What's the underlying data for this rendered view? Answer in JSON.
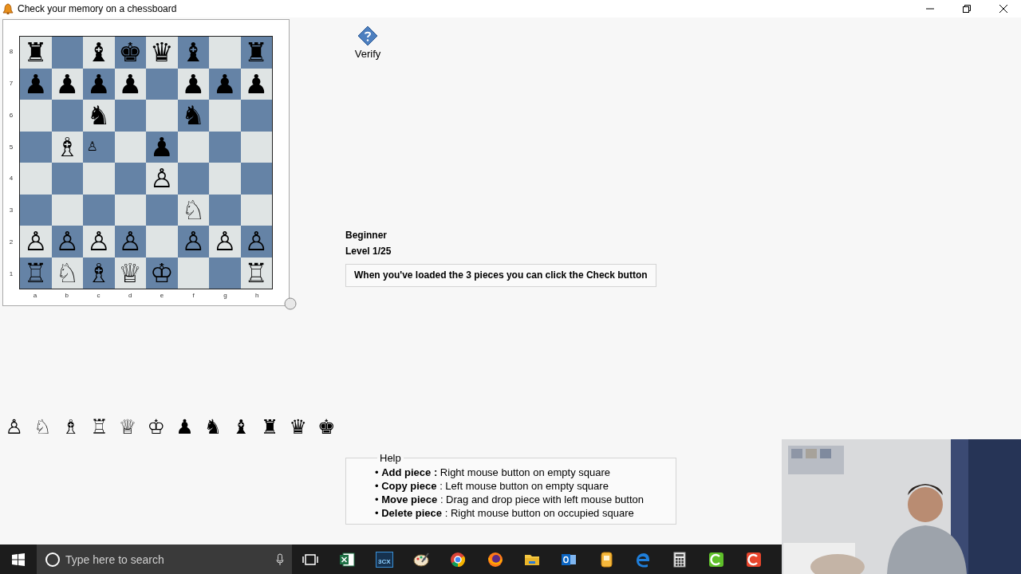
{
  "window": {
    "title": "Check your memory on a chessboard"
  },
  "board": {
    "files": [
      "a",
      "b",
      "c",
      "d",
      "e",
      "f",
      "g",
      "h"
    ],
    "ranks": [
      {
        "label": "8",
        "squares": [
          {
            "dark": false,
            "piece": "♜"
          },
          {
            "dark": true
          },
          {
            "dark": false,
            "piece": "♝"
          },
          {
            "dark": true,
            "piece": "♚"
          },
          {
            "dark": false,
            "piece": "♛"
          },
          {
            "dark": true,
            "piece": "♝"
          },
          {
            "dark": false
          },
          {
            "dark": true,
            "piece": "♜"
          }
        ]
      },
      {
        "label": "7",
        "squares": [
          {
            "dark": true,
            "piece": "♟"
          },
          {
            "dark": false,
            "piece": "♟"
          },
          {
            "dark": true,
            "piece": "♟"
          },
          {
            "dark": false,
            "piece": "♟"
          },
          {
            "dark": true
          },
          {
            "dark": false,
            "piece": "♟"
          },
          {
            "dark": true,
            "piece": "♟"
          },
          {
            "dark": false,
            "piece": "♟"
          }
        ]
      },
      {
        "label": "6",
        "squares": [
          {
            "dark": false
          },
          {
            "dark": true
          },
          {
            "dark": false,
            "piece": "♞"
          },
          {
            "dark": true
          },
          {
            "dark": false
          },
          {
            "dark": true,
            "piece": "♞"
          },
          {
            "dark": false
          },
          {
            "dark": true
          }
        ]
      },
      {
        "label": "5",
        "squares": [
          {
            "dark": true
          },
          {
            "dark": false,
            "piece": "♗"
          },
          {
            "dark": true,
            "piece": "♙",
            "kind": "mini"
          },
          {
            "dark": false
          },
          {
            "dark": true,
            "piece": "♟"
          },
          {
            "dark": false
          },
          {
            "dark": true
          },
          {
            "dark": false
          }
        ]
      },
      {
        "label": "4",
        "squares": [
          {
            "dark": false
          },
          {
            "dark": true
          },
          {
            "dark": false
          },
          {
            "dark": true
          },
          {
            "dark": false,
            "piece": "♙"
          },
          {
            "dark": true
          },
          {
            "dark": false
          },
          {
            "dark": true
          }
        ]
      },
      {
        "label": "3",
        "squares": [
          {
            "dark": true
          },
          {
            "dark": false
          },
          {
            "dark": true
          },
          {
            "dark": false
          },
          {
            "dark": true
          },
          {
            "dark": false,
            "piece": "♘"
          },
          {
            "dark": true
          },
          {
            "dark": false
          }
        ]
      },
      {
        "label": "2",
        "squares": [
          {
            "dark": false,
            "piece": "♙"
          },
          {
            "dark": true,
            "piece": "♙"
          },
          {
            "dark": false,
            "piece": "♙"
          },
          {
            "dark": true,
            "piece": "♙"
          },
          {
            "dark": false
          },
          {
            "dark": true,
            "piece": "♙"
          },
          {
            "dark": false,
            "piece": "♙"
          },
          {
            "dark": true,
            "piece": "♙"
          }
        ]
      },
      {
        "label": "1",
        "squares": [
          {
            "dark": true,
            "piece": "♖"
          },
          {
            "dark": false,
            "piece": "♘"
          },
          {
            "dark": true,
            "piece": "♗"
          },
          {
            "dark": false,
            "piece": "♕"
          },
          {
            "dark": true,
            "piece": "♔"
          },
          {
            "dark": false
          },
          {
            "dark": true
          },
          {
            "dark": false,
            "piece": "♖"
          }
        ]
      }
    ]
  },
  "verify_button": {
    "label": "Verify"
  },
  "level": {
    "difficulty": "Beginner",
    "level": "Level 1/25"
  },
  "message": "When you've loaded the 3 pieces you can click the Check button",
  "palette": [
    "♙",
    "♘",
    "♗",
    "♖",
    "♕",
    "♔",
    "♟",
    "♞",
    "♝",
    "♜",
    "♛",
    "♚"
  ],
  "help": {
    "title": "Help",
    "items": [
      "• **Add piece :** Right mouse button on empty square",
      "• **Copy piece** : Left mouse button on empty square",
      "• **Move piece** : Drag and drop piece with left mouse button",
      "• **Delete piece** : Right mouse button on occupied square"
    ]
  },
  "taskbar": {
    "search_placeholder": "Type here to search",
    "apps": [
      {
        "kind": "excel"
      },
      {
        "kind": "phone",
        "label": "3CX"
      },
      {
        "kind": "paint"
      },
      {
        "kind": "chrome"
      },
      {
        "kind": "firefox"
      },
      {
        "kind": "folder"
      },
      {
        "kind": "outlook"
      },
      {
        "kind": "notes"
      },
      {
        "kind": "edge"
      },
      {
        "kind": "calculator"
      },
      {
        "kind": "camtasiagreen"
      },
      {
        "kind": "camtasiared"
      }
    ]
  }
}
